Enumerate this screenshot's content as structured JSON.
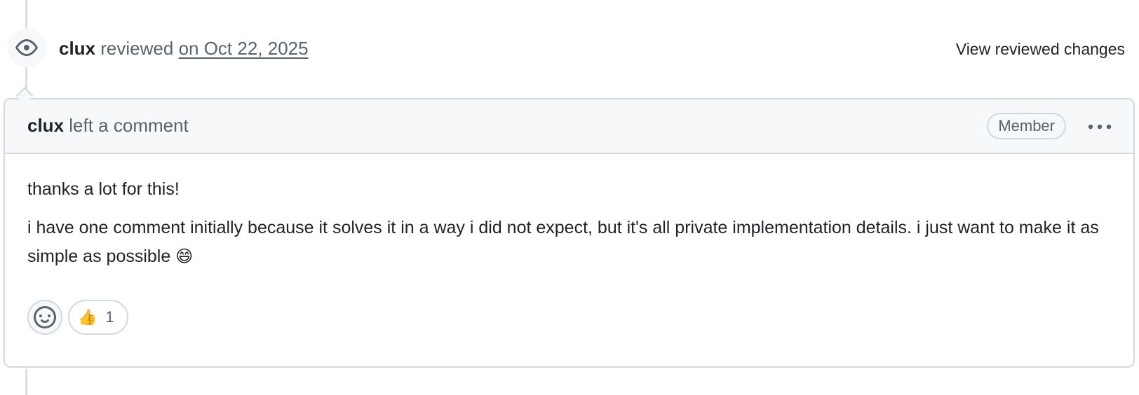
{
  "event": {
    "icon": "eye-icon",
    "author": "clux",
    "action": "reviewed",
    "date": "on Oct 22, 2025",
    "view_changes_label": "View reviewed changes"
  },
  "comment": {
    "author": "clux",
    "action": "left a comment",
    "role_label": "Member",
    "menu_icon": "kebab-horizontal-icon",
    "paragraphs": [
      "thanks a lot for this!",
      "i have one comment initially because it solves it in a way i did not expect, but it's all private implementation details. i just want to make it as simple as possible"
    ],
    "inline_emoji": "😄"
  },
  "reactions": {
    "add_icon": "smiley-icon",
    "items": [
      {
        "emoji": "👍",
        "count": "1",
        "icon": "thumbs-up-icon"
      }
    ]
  },
  "colors": {
    "border": "#d1d9e0",
    "header_bg": "#f6f8fa",
    "text": "#1f2328",
    "muted": "#59636e",
    "timeline": "#d8dee4"
  }
}
